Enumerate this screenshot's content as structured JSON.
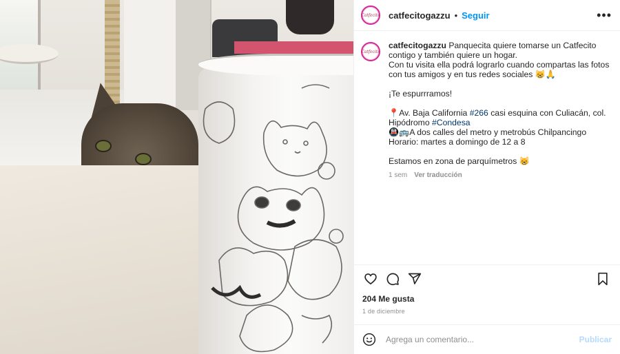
{
  "post": {
    "username": "catfecitogazzu",
    "follow_label": "Seguir",
    "separator": "•",
    "more_label": "•••",
    "avatar_text": "Catfecito",
    "caption_lines": [
      "Panquecita quiere tomarse un Catfecito contigo y también quiere un hogar.",
      "Con tu visita ella podrá lograrlo cuando compartas las fotos con tus amigos y en tus redes sociales 😸🙏"
    ],
    "caption_exclaim": "¡Te espurrramos!",
    "address_pin": "📍",
    "address_prefix": "Av. Baja California ",
    "address_tag1": "#266",
    "address_mid": " casi esquina con Culiacán, col. Hipódromo ",
    "address_tag2": "#Condesa",
    "transport_icons": "🚇🚌",
    "transport_text": "A dos calles del metro y metrobús Chilpancingo",
    "schedule": "Horario: martes a domingo de 12 a 8",
    "parking": "Estamos en zona de parquímetros 😸",
    "time_ago": "1 sem",
    "translate_label": "Ver traducción",
    "likes": "204 Me gusta",
    "date": "1 de diciembre",
    "comment_placeholder": "Agrega un comentario...",
    "post_button": "Publicar"
  },
  "icons": {
    "like": "heart-icon",
    "comment": "comment-icon",
    "share": "send-icon",
    "save": "bookmark-icon",
    "emoji": "smiley-icon"
  },
  "colors": {
    "link_blue": "#0095f6",
    "hashtag": "#00376b",
    "muted": "#8e8e8e",
    "avatar_ring": "#d6249f"
  }
}
